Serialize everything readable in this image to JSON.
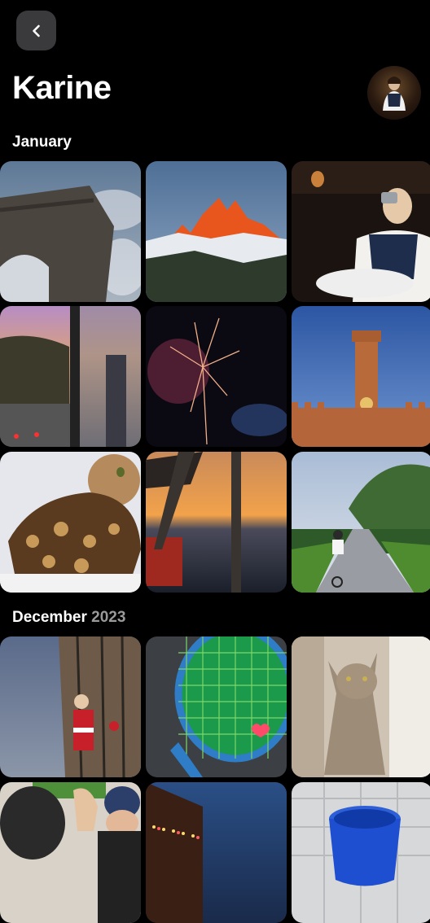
{
  "header": {
    "title": "Karine"
  },
  "sections": [
    {
      "month": "January",
      "year": "",
      "photos": [
        "arch-monument",
        "orange-mountain-peaks",
        "person-with-camera",
        "sunset-city-window",
        "fireworks",
        "clock-tower",
        "cat-in-leopard-sweater",
        "sunset-over-sea-ferris-wheel",
        "cyclist-on-path"
      ]
    },
    {
      "month": "December",
      "year": "2023",
      "photos": [
        "santa-decoration-building",
        "tennis-racket",
        "abyssinian-cat",
        "gorilla-statue-people",
        "dusk-sea-lights",
        "blue-bucket-tiles"
      ]
    }
  ]
}
